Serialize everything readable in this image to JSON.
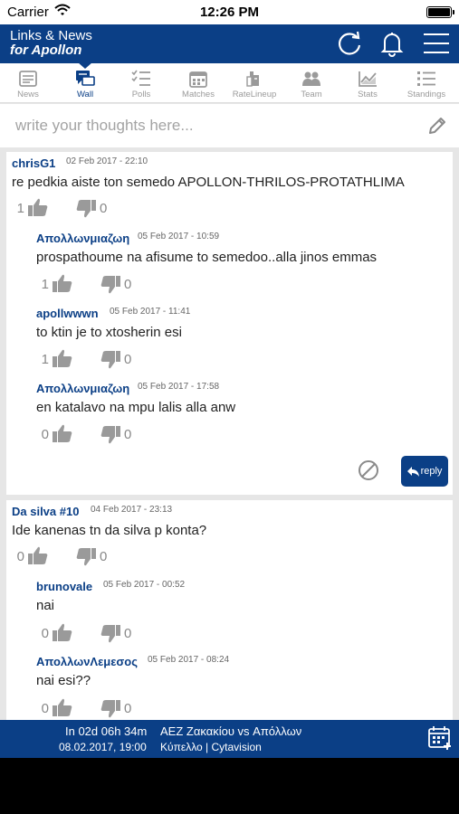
{
  "status_bar": {
    "carrier": "Carrier",
    "time": "12:26 PM"
  },
  "header": {
    "title_line1": "Links & News",
    "title_line2": "for Apollon"
  },
  "tabs": [
    {
      "label": "News",
      "icon": "news-icon"
    },
    {
      "label": "Wall",
      "icon": "wall-chat-icon",
      "active": true
    },
    {
      "label": "Polls",
      "icon": "polls-list-icon"
    },
    {
      "label": "Matches",
      "icon": "calendar-icon"
    },
    {
      "label": "RateLineup",
      "icon": "lineup-icon"
    },
    {
      "label": "Team",
      "icon": "team-icon"
    },
    {
      "label": "Stats",
      "icon": "stats-chart-icon"
    },
    {
      "label": "Standings",
      "icon": "standings-list-icon"
    }
  ],
  "compose": {
    "placeholder": "write your thoughts here..."
  },
  "posts": [
    {
      "author": "chrisG1",
      "date": "02 Feb 2017 - 22:10",
      "text": "re pedkia aiste ton semedo APOLLON-THRILOS-PROTATHLIMA",
      "likes": "1",
      "dislikes": "0",
      "replies": [
        {
          "author": "Απολλωνμιαζωη",
          "date": "05 Feb 2017 - 10:59",
          "text": "prospathoume na afisume to semedoo..alla jinos emmas",
          "likes": "1",
          "dislikes": "0"
        },
        {
          "author": "apollwwwn",
          "date": "05 Feb 2017 - 11:41",
          "text": "to ktin je to xtosherin esi",
          "likes": "1",
          "dislikes": "0"
        },
        {
          "author": "Απολλωνμιαζωη",
          "date": "05 Feb 2017 - 17:58",
          "text": "en katalavo na mpu lalis alla anw",
          "likes": "0",
          "dislikes": "0"
        }
      ],
      "reply_label": "reply"
    },
    {
      "author": "Da silva #10",
      "date": "04 Feb 2017 - 23:13",
      "text": "Ide kanenas tn da silva p konta?",
      "likes": "0",
      "dislikes": "0",
      "replies": [
        {
          "author": "brunovale",
          "date": "05 Feb 2017 - 00:52",
          "text": "nai",
          "likes": "0",
          "dislikes": "0"
        },
        {
          "author": "ΑπολλωνΛεμεσος",
          "date": "05 Feb 2017 - 08:24",
          "text": "nai esi??",
          "likes": "0",
          "dislikes": "0"
        }
      ]
    }
  ],
  "next_match": {
    "countdown": "In 02d 06h 34m",
    "datetime": "08.02.2017, 19:00",
    "fixture": "ΑΕΖ Ζακακίου vs Απόλλων",
    "venue": "Κύπελλο | Cytavision"
  },
  "colors": {
    "brand": "#0b3f86",
    "icon_gray": "#9a9a9a",
    "background": "#e6e6e6"
  }
}
